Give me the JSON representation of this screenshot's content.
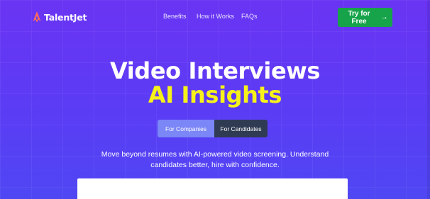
{
  "brand": {
    "name": "TalentJet",
    "icon": "flame-icon",
    "icon_color": "#ff6b5a"
  },
  "nav": {
    "items": [
      {
        "label": "Benefits"
      },
      {
        "label": "How it Works"
      },
      {
        "label": "FAQs"
      }
    ]
  },
  "cta": {
    "label": "Try for Free",
    "icon": "arrow-right-icon",
    "color": "#16a34a"
  },
  "hero": {
    "title_line1": "Video Interviews",
    "title_line2": "AI Insights",
    "title_line2_color": "#f6f21a",
    "toggle": {
      "options": [
        {
          "label": "For Companies",
          "selected": true
        },
        {
          "label": "For Candidates",
          "selected": false
        }
      ]
    },
    "subtext_line1": "Move beyond resumes with AI-powered video screening. Understand",
    "subtext_line2": "candidates better, hire with confidence."
  },
  "colors": {
    "background": "#5b3cf5",
    "toggle_active": "#7b86f7",
    "toggle_inactive": "#2f3b52"
  }
}
